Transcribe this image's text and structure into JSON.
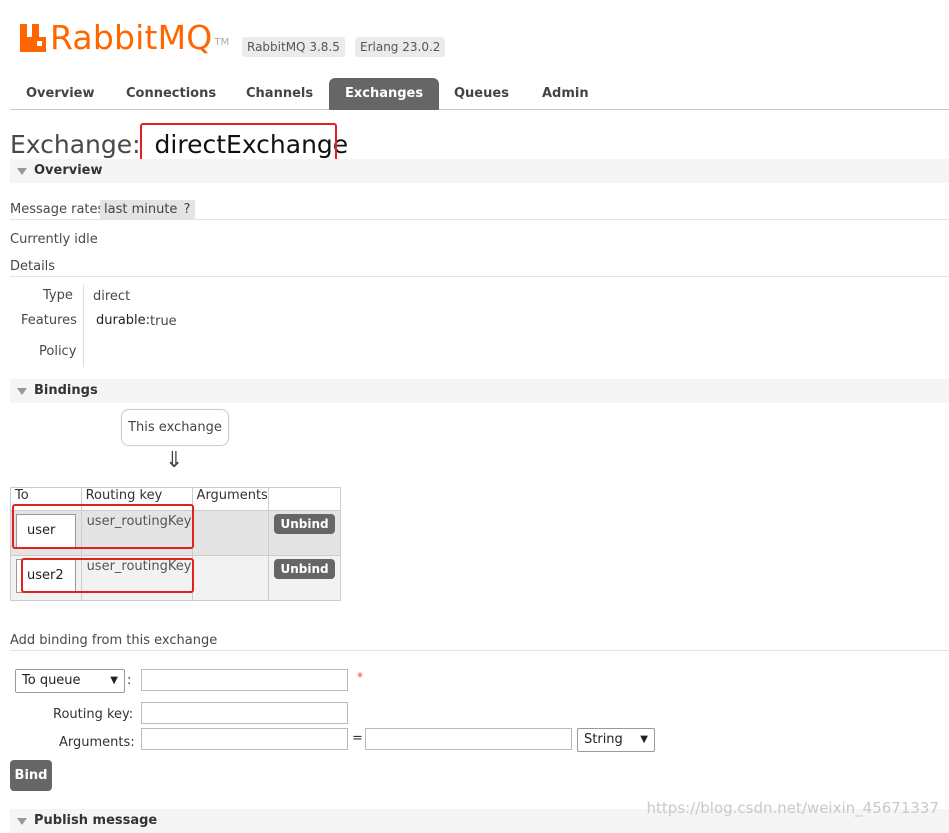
{
  "header": {
    "logo_text": "RabbitMQ",
    "logo_tm": "TM",
    "version": "RabbitMQ 3.8.5",
    "erlang": "Erlang 23.0.2",
    "brand_color": "#ff6600"
  },
  "tabs": [
    {
      "label": "Overview"
    },
    {
      "label": "Connections"
    },
    {
      "label": "Channels"
    },
    {
      "label": "Exchanges",
      "active": true
    },
    {
      "label": "Queues"
    },
    {
      "label": "Admin"
    }
  ],
  "page": {
    "title_prefix": "Exchange:",
    "exchange_name": "directExchange"
  },
  "overview": {
    "section_label": "Overview",
    "message_rates_label": "Message rates",
    "rate_period": "last minute",
    "help": "?",
    "status": "Currently idle",
    "details_label": "Details",
    "type_label": "Type",
    "type_value": "direct",
    "features_label": "Features",
    "durable_label": "durable:",
    "durable_value": "true",
    "policy_label": "Policy"
  },
  "bindings": {
    "section_label": "Bindings",
    "this_exchange": "This exchange",
    "arrow": "⇓",
    "headers": {
      "to": "To",
      "routing_key": "Routing key",
      "arguments": "Arguments"
    },
    "rows": [
      {
        "to": "user",
        "routing_key": "user_routingKey",
        "arguments": "",
        "action": "Unbind"
      },
      {
        "to": "user2",
        "routing_key": "user_routingKey",
        "arguments": "",
        "action": "Unbind"
      }
    ]
  },
  "add_binding": {
    "label": "Add binding from this exchange",
    "dest_type": "To queue",
    "colon": ":",
    "required": "*",
    "routing_key_label": "Routing key:",
    "arguments_label": "Arguments:",
    "equals": "=",
    "arg_type": "String",
    "bind_button": "Bind"
  },
  "publish": {
    "section_label": "Publish message"
  },
  "watermark": "https://blog.csdn.net/weixin_45671337"
}
